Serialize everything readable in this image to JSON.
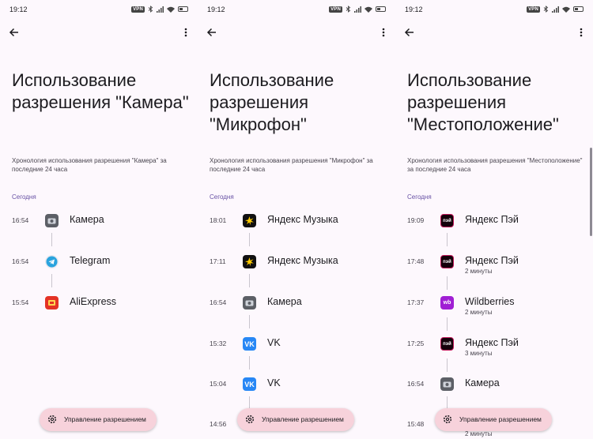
{
  "status_time": "19:12",
  "vpn_label": "VPN",
  "manage_label": "Управление разрешением",
  "section_label": "Сегодня",
  "colors": {
    "accent": "#6750a4",
    "fab": "#f7d2db",
    "background": "#fdf8fd"
  },
  "screens": [
    {
      "title": "Использование разрешения \"Камера\"",
      "subtitle": "Хронология использования разрешения \"Камера\" за последние 24 часа",
      "entries": [
        {
          "time": "16:54",
          "app": "Камера",
          "icon": "camera-app-icon"
        },
        {
          "time": "16:54",
          "app": "Telegram",
          "icon": "telegram-icon"
        },
        {
          "time": "15:54",
          "app": "AliExpress",
          "icon": "aliexpress-icon"
        }
      ]
    },
    {
      "title": "Использование разрешения \"Микрофон\"",
      "subtitle": "Хронология использования разрешения \"Микрофон\" за последние 24 часа",
      "entries": [
        {
          "time": "18:01",
          "app": "Яндекс Музыка",
          "icon": "yandex-music-icon"
        },
        {
          "time": "17:11",
          "app": "Яндекс Музыка",
          "icon": "yandex-music-icon"
        },
        {
          "time": "16:54",
          "app": "Камера",
          "icon": "camera-app-icon"
        },
        {
          "time": "15:32",
          "app": "VK",
          "icon": "vk-icon"
        },
        {
          "time": "15:04",
          "app": "VK",
          "icon": "vk-icon"
        },
        {
          "time": "14:56",
          "app": "",
          "icon": ""
        }
      ]
    },
    {
      "title": "Использование разрешения \"Местоположение\"",
      "subtitle": "Хронология использования разрешения \"Местоположение\" за последние 24 часа",
      "entries": [
        {
          "time": "19:09",
          "app": "Яндекс Пэй",
          "icon": "yandex-pay-icon"
        },
        {
          "time": "17:48",
          "app": "Яндекс Пэй",
          "duration": "2 минуты",
          "icon": "yandex-pay-icon"
        },
        {
          "time": "17:37",
          "app": "Wildberries",
          "duration": "2 минуты",
          "icon": "wildberries-icon"
        },
        {
          "time": "17:25",
          "app": "Яндекс Пэй",
          "duration": "3 минуты",
          "icon": "yandex-pay-icon"
        },
        {
          "time": "16:54",
          "app": "Камера",
          "icon": "camera-app-icon"
        },
        {
          "time": "15:48",
          "app": "",
          "duration": "2 минуты",
          "icon": ""
        }
      ]
    }
  ]
}
